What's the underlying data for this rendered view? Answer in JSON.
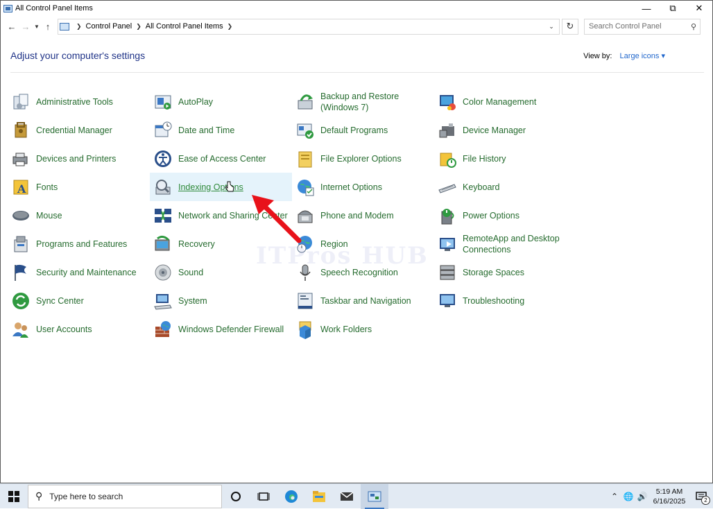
{
  "window": {
    "title": "All Control Panel Items"
  },
  "address": {
    "crumbs": [
      "Control Panel",
      "All Control Panel Items"
    ]
  },
  "search": {
    "placeholder": "Search Control Panel"
  },
  "header": {
    "heading": "Adjust your computer's settings",
    "view_by_label": "View by:",
    "view_by_value": "Large icons"
  },
  "items": [
    {
      "label": "Administrative Tools",
      "icon": "administrative-tools-icon"
    },
    {
      "label": "AutoPlay",
      "icon": "autoplay-icon"
    },
    {
      "label": "Backup and Restore (Windows 7)",
      "icon": "backup-restore-icon"
    },
    {
      "label": "Color Management",
      "icon": "color-management-icon"
    },
    {
      "label": "Credential Manager",
      "icon": "credential-manager-icon"
    },
    {
      "label": "Date and Time",
      "icon": "date-time-icon"
    },
    {
      "label": "Default Programs",
      "icon": "default-programs-icon"
    },
    {
      "label": "Device Manager",
      "icon": "device-manager-icon"
    },
    {
      "label": "Devices and Printers",
      "icon": "devices-printers-icon"
    },
    {
      "label": "Ease of Access Center",
      "icon": "ease-of-access-icon"
    },
    {
      "label": "File Explorer Options",
      "icon": "file-explorer-options-icon"
    },
    {
      "label": "File History",
      "icon": "file-history-icon"
    },
    {
      "label": "Fonts",
      "icon": "fonts-icon"
    },
    {
      "label": "Indexing Options",
      "icon": "indexing-options-icon"
    },
    {
      "label": "Internet Options",
      "icon": "internet-options-icon"
    },
    {
      "label": "Keyboard",
      "icon": "keyboard-icon"
    },
    {
      "label": "Mouse",
      "icon": "mouse-icon"
    },
    {
      "label": "Network and Sharing Center",
      "icon": "network-sharing-icon"
    },
    {
      "label": "Phone and Modem",
      "icon": "phone-modem-icon"
    },
    {
      "label": "Power Options",
      "icon": "power-options-icon"
    },
    {
      "label": "Programs and Features",
      "icon": "programs-features-icon"
    },
    {
      "label": "Recovery",
      "icon": "recovery-icon"
    },
    {
      "label": "Region",
      "icon": "region-icon"
    },
    {
      "label": "RemoteApp and Desktop Connections",
      "icon": "remoteapp-icon"
    },
    {
      "label": "Security and Maintenance",
      "icon": "security-maintenance-icon"
    },
    {
      "label": "Sound",
      "icon": "sound-icon"
    },
    {
      "label": "Speech Recognition",
      "icon": "speech-recognition-icon"
    },
    {
      "label": "Storage Spaces",
      "icon": "storage-spaces-icon"
    },
    {
      "label": "Sync Center",
      "icon": "sync-center-icon"
    },
    {
      "label": "System",
      "icon": "system-icon"
    },
    {
      "label": "Taskbar and Navigation",
      "icon": "taskbar-navigation-icon"
    },
    {
      "label": "Troubleshooting",
      "icon": "troubleshooting-icon"
    },
    {
      "label": "User Accounts",
      "icon": "user-accounts-icon"
    },
    {
      "label": "Windows Defender Firewall",
      "icon": "firewall-icon"
    },
    {
      "label": "Work Folders",
      "icon": "work-folders-icon"
    }
  ],
  "highlighted_item": "Indexing Options",
  "watermark": "ITPros HUB",
  "taskbar": {
    "search_placeholder": "Type here to search",
    "time": "5:19 AM",
    "date": "6/16/2025",
    "notification_count": "2"
  },
  "colors": {
    "link_green": "#256b2e",
    "heading_blue": "#1e3287",
    "highlight": "#e5f3fb",
    "arrow_red": "#e8121a"
  }
}
